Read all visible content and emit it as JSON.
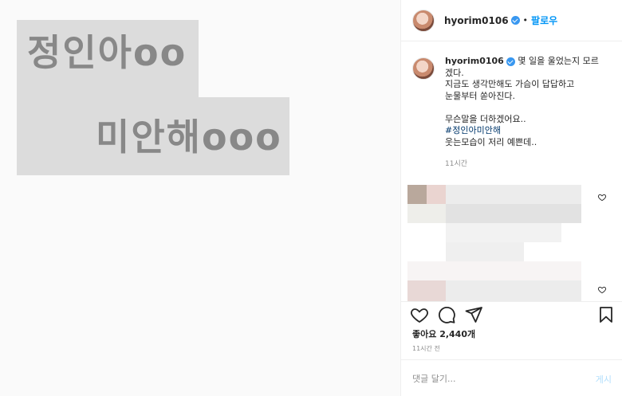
{
  "image": {
    "line1": "정인아oo",
    "line2": "미안해ooo"
  },
  "header": {
    "username": "hyorim0106",
    "separator": "•",
    "follow_label": "팔로우"
  },
  "caption": {
    "username": "hyorim0106",
    "lines": [
      "몇 일을 울었는지 모르",
      "겠다.",
      "지금도 생각만해도 가슴이 답답하고",
      "눈물부터 쏟아진다.",
      "",
      "무슨말을 더하겠어요..",
      "#정인아미안해",
      "웃는모습이 저리 예쁜데.."
    ],
    "time": "11시간"
  },
  "engagement": {
    "likes": "좋아요 2,440개",
    "time": "11시간 전"
  },
  "comment_box": {
    "placeholder": "댓글 달기...",
    "post_label": "게시"
  },
  "icons": {
    "verified": "verified-badge-icon",
    "like": "heart-icon",
    "comment": "comment-icon",
    "share": "share-icon",
    "save": "bookmark-icon"
  },
  "colors": {
    "link": "#0095f6",
    "hashtag": "#00376b",
    "muted": "#8e8e8e",
    "verified": "#3897f0"
  }
}
